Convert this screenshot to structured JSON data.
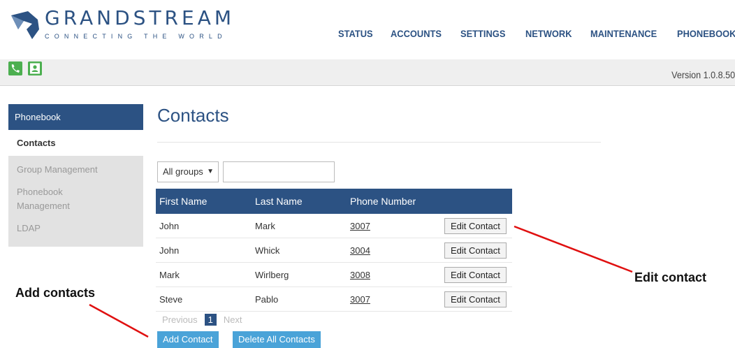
{
  "brand": {
    "name": "GRANDSTREAM",
    "tagline": "CONNECTING THE WORLD"
  },
  "nav": [
    "STATUS",
    "ACCOUNTS",
    "SETTINGS",
    "NETWORK",
    "MAINTENANCE",
    "PHONEBOOK"
  ],
  "toolbar": {
    "icons": [
      "phone-call-icon",
      "contact-card-icon"
    ],
    "version": "Version 1.0.8.50"
  },
  "sidebar": {
    "header": "Phonebook",
    "active": "Contacts",
    "items": [
      "Group Management",
      "Phonebook Management",
      "LDAP"
    ]
  },
  "main": {
    "title": "Contacts",
    "group_select": "All groups",
    "search_value": "",
    "table": {
      "headers": [
        "First Name",
        "Last Name",
        "Phone Number"
      ],
      "rows": [
        [
          "John",
          "Mark",
          "3007"
        ],
        [
          "John",
          "Whick",
          "3004"
        ],
        [
          "Mark",
          "Wirlberg",
          "3008"
        ],
        [
          "Steve",
          "Pablo",
          "3007"
        ]
      ],
      "edit_label": "Edit Contact"
    },
    "pager": {
      "prev": "Previous",
      "page": "1",
      "next": "Next"
    },
    "buttons": {
      "add": "Add Contact",
      "delete_all": "Delete All Contacts"
    }
  },
  "annotations": {
    "edit": "Edit contact",
    "add": "Add contacts"
  },
  "colors": {
    "brand_blue": "#2c5283",
    "button_blue": "#4aa3d8",
    "icon_green": "#4caf50",
    "arrow_red": "#e01010"
  }
}
